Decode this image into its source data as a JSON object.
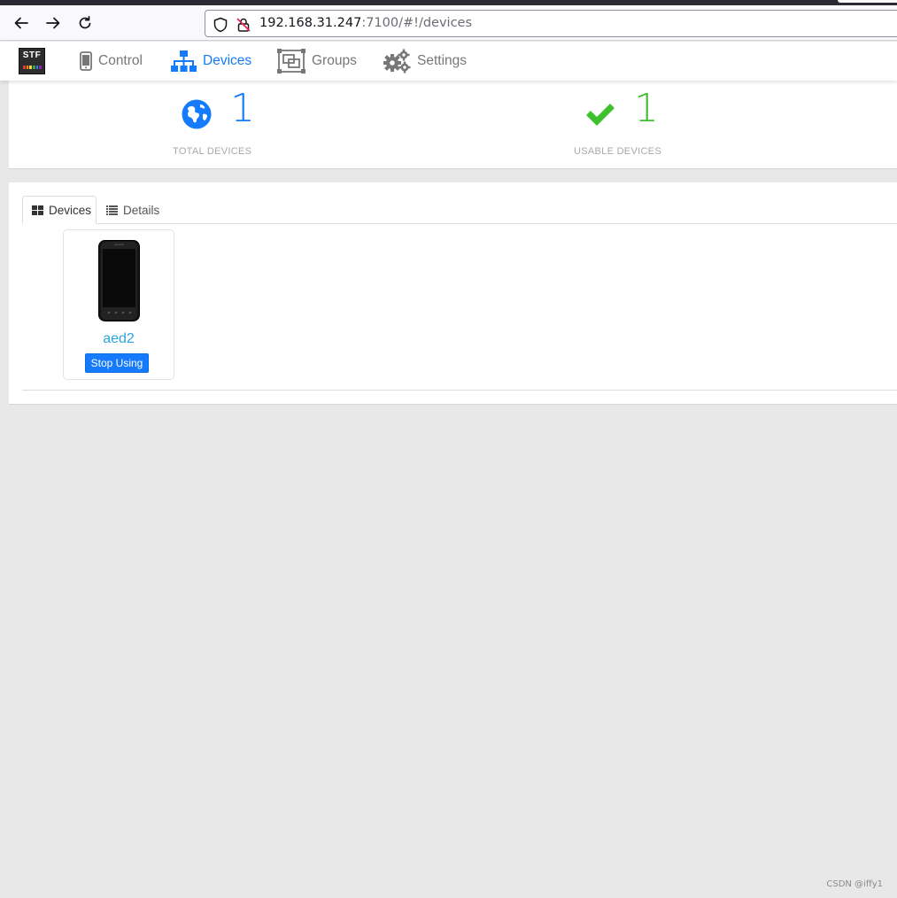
{
  "browser": {
    "url_host": "192.168.31.247",
    "url_rest": ":7100/#!/devices"
  },
  "nav": {
    "items": [
      {
        "label": "Control",
        "active": false
      },
      {
        "label": "Devices",
        "active": true
      },
      {
        "label": "Groups",
        "active": false
      },
      {
        "label": "Settings",
        "active": false
      }
    ],
    "logo_text": "STF"
  },
  "stats": {
    "total": {
      "value": "1",
      "label": "TOTAL DEVICES",
      "color": "#157afb"
    },
    "usable": {
      "value": "1",
      "label": "USABLE DEVICES",
      "color": "#3fc12e"
    }
  },
  "device_view": {
    "tabs": [
      {
        "label": "Devices",
        "active": true
      },
      {
        "label": "Details",
        "active": false
      }
    ],
    "devices": [
      {
        "name": "aed2",
        "action_label": "Stop Using"
      }
    ]
  },
  "watermark": "CSDN @iffy1",
  "colors": {
    "accent": "#157afb",
    "device_link": "#2aa6e0"
  }
}
